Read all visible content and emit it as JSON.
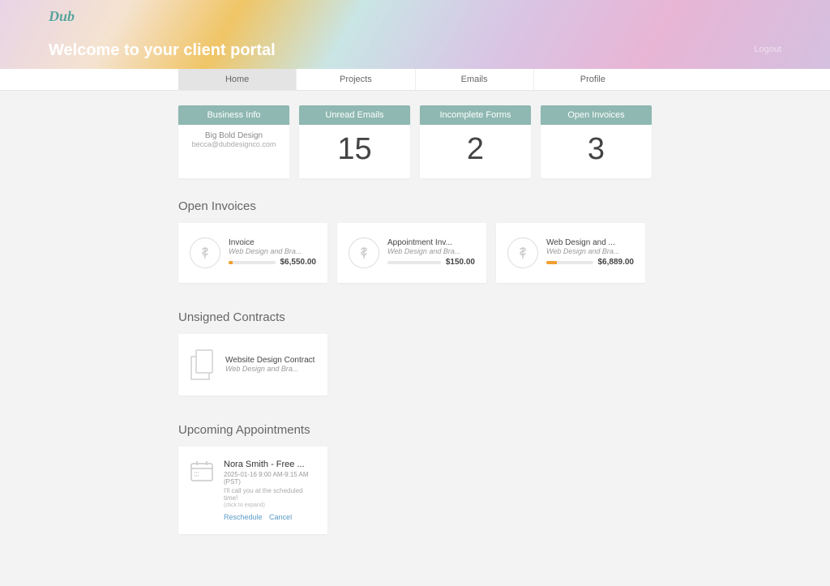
{
  "brand": "Dub",
  "hero": {
    "welcome": "Welcome to your client portal",
    "logout": "Logout"
  },
  "tabs": [
    "Home",
    "Projects",
    "Emails",
    "Profile"
  ],
  "active_tab": 0,
  "stats": {
    "business": {
      "header": "Business Info",
      "name": "Big Bold Design",
      "email": "becca@dubdesignco.com"
    },
    "unread_emails": {
      "header": "Unread Emails",
      "value": "15"
    },
    "incomplete_forms": {
      "header": "Incomplete Forms",
      "value": "2"
    },
    "open_invoices": {
      "header": "Open Invoices",
      "value": "3"
    }
  },
  "sections": {
    "open_invoices": {
      "title": "Open Invoices",
      "items": [
        {
          "title": "Invoice",
          "sub": "Web Design and Bra...",
          "amount": "$6,550.00",
          "progress_pct": 8
        },
        {
          "title": "Appointment Inv...",
          "sub": "Web Design and Bra...",
          "amount": "$150.00",
          "progress_pct": 0
        },
        {
          "title": "Web Design and ...",
          "sub": "Web Design and Bra...",
          "amount": "$6,889.00",
          "progress_pct": 22
        }
      ]
    },
    "unsigned_contracts": {
      "title": "Unsigned Contracts",
      "items": [
        {
          "title": "Website Design Contract",
          "sub": "Web Design and Bra..."
        }
      ]
    },
    "upcoming_appointments": {
      "title": "Upcoming Appointments",
      "items": [
        {
          "title": "Nora Smith - Free ...",
          "time": "2025-01-16 9:00 AM-9:15 AM (PST)",
          "note": "I'll call you at the scheduled time!",
          "hint": "(click to expand)",
          "reschedule": "Reschedule",
          "cancel": "Cancel"
        }
      ]
    }
  }
}
